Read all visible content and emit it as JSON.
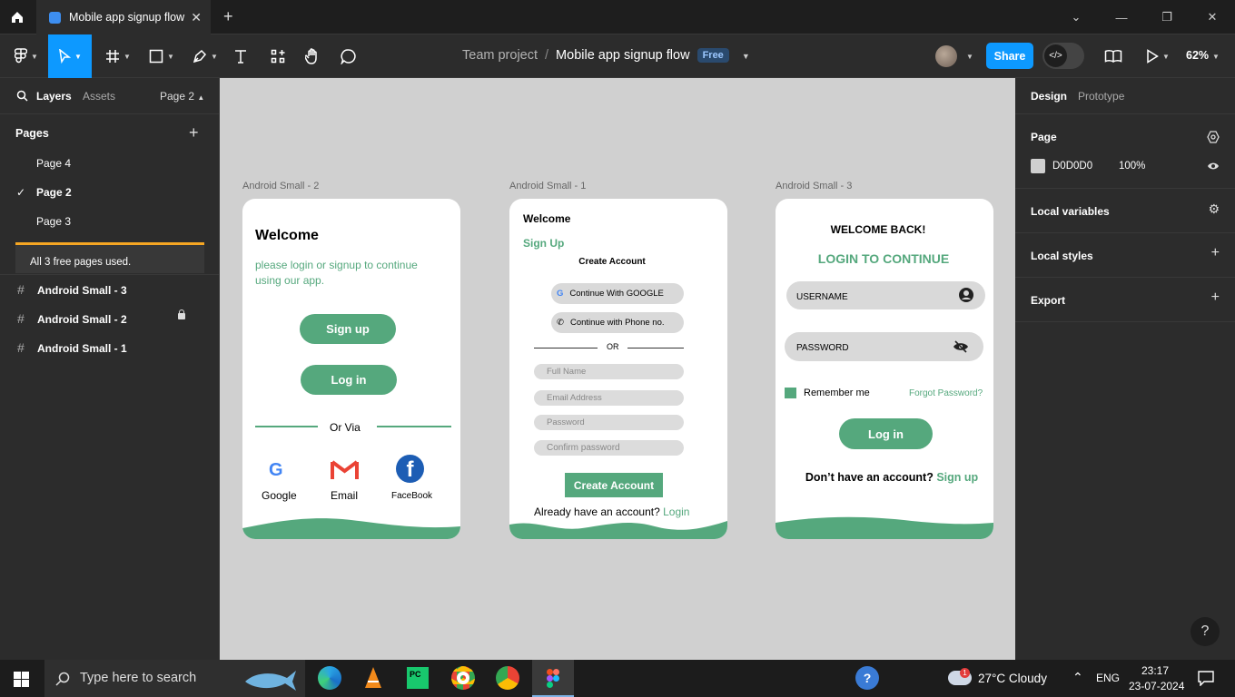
{
  "browser": {
    "tab_title": "Mobile app signup flow"
  },
  "toolbar": {
    "project": "Team project",
    "separator": "/",
    "file": "Mobile app signup flow",
    "plan_badge": "Free",
    "share": "Share",
    "zoom": "62%"
  },
  "left_panel": {
    "tab_layers": "Layers",
    "tab_assets": "Assets",
    "page_selector": "Page 2",
    "pages_heading": "Pages",
    "pages": [
      "Page 4",
      "Page 2",
      "Page 3"
    ],
    "warning": "All 3 free pages used.",
    "layers": [
      "Android Small - 3",
      "Android Small - 2",
      "Android Small - 1"
    ]
  },
  "right_panel": {
    "tab_design": "Design",
    "tab_prototype": "Prototype",
    "page_heading": "Page",
    "page_color": "D0D0D0",
    "page_opacity": "100%",
    "local_variables": "Local variables",
    "local_styles": "Local styles",
    "export": "Export"
  },
  "canvas": {
    "bg": "#d0d0d0",
    "frame2": {
      "label": "Android Small - 2",
      "title": "Welcome",
      "subtitle": "please login or signup to continue using our app.",
      "signup": "Sign up",
      "login": "Log in",
      "or_via": "Or Via",
      "google": "Google",
      "email": "Email",
      "facebook": "FaceBook"
    },
    "frame1": {
      "label": "Android Small - 1",
      "welcome": "Welcome",
      "signup": "Sign Up",
      "create_heading": "Create Account",
      "google_btn": "Continue With GOOGLE",
      "phone_btn": "Continue with Phone no.",
      "or": "OR",
      "fields": [
        "Full Name",
        "Email Address",
        "Password",
        "Confirm password"
      ],
      "create_btn": "Create Account",
      "have_account": "Already have an account?",
      "login_link": "Login"
    },
    "frame3": {
      "label": "Android Small - 3",
      "welcome": "WELCOME BACK!",
      "login_heading": "LOGIN TO CONTINUE",
      "username": "USERNAME",
      "password": "PASSWORD",
      "remember": "Remember me",
      "forgot": "Forgot Password?",
      "login_btn": "Log in",
      "no_account": "Don’t have an account?",
      "signup_link": "Sign up"
    }
  },
  "taskbar": {
    "search_placeholder": "Type here to search",
    "weather": "27°C  Cloudy",
    "weather_badge": "1",
    "lang": "ENG",
    "time": "23:17",
    "date": "23-07-2024"
  },
  "colors": {
    "accent": "#0d99ff",
    "green": "#55a87d",
    "warning": "#f5a623"
  }
}
